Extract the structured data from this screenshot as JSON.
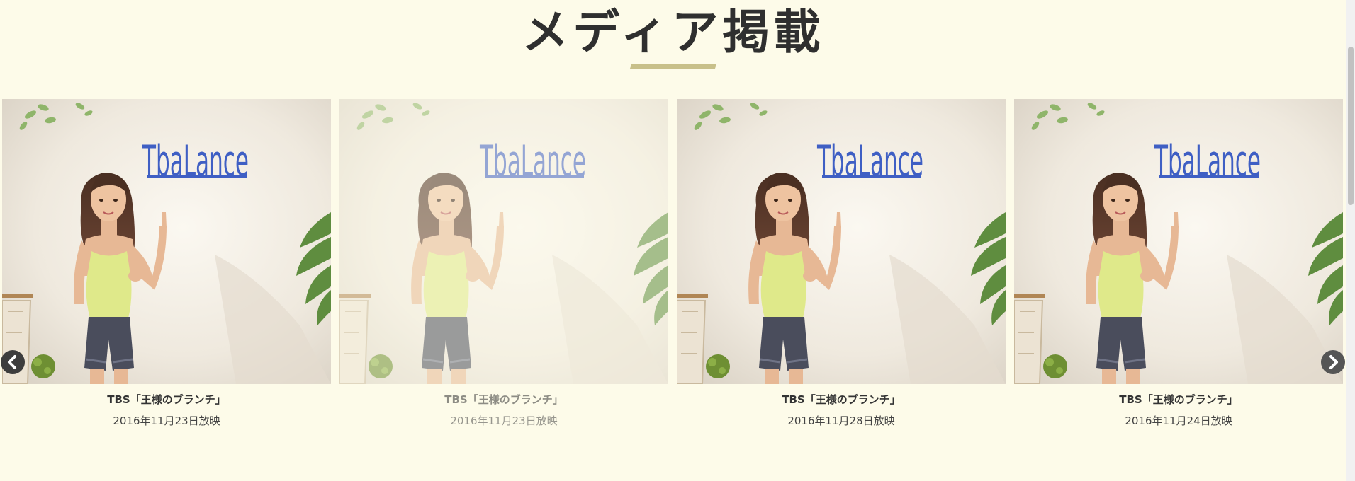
{
  "section": {
    "title": "メディア掲載"
  },
  "colors": {
    "background": "#fdfbe9",
    "underline_accent": "#c8c08a",
    "logo_blue": "#3f5fc4",
    "top_color": "#dfe98a",
    "shorts_color": "#4a4d5c"
  },
  "carousel": {
    "items": [
      {
        "image_logo_text": "TbaLance",
        "title": "TBS「王様のブランチ」",
        "date": "2016年11月23日放映",
        "state": "active"
      },
      {
        "image_logo_text": "TbaLance",
        "title": "TBS「王様のブランチ」",
        "date": "2016年11月23日放映",
        "state": "dimmed"
      },
      {
        "image_logo_text": "TbaLance",
        "title": "TBS「王様のブランチ」",
        "date": "2016年11月28日放映",
        "state": "active"
      },
      {
        "image_logo_text": "TbaLance",
        "title": "TBS「王様のブランチ」",
        "date": "2016年11月24日放映",
        "state": "active"
      }
    ],
    "prev_icon": "chevron-left-icon",
    "next_icon": "chevron-right-icon"
  }
}
